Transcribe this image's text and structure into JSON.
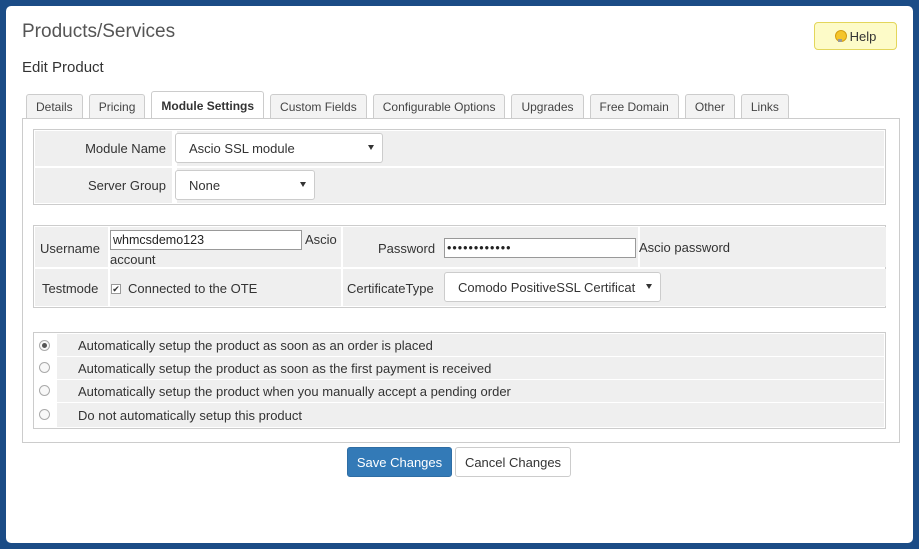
{
  "page": {
    "title": "Products/Services",
    "subtitle": "Edit Product"
  },
  "help": {
    "label": "Help",
    "icon": "lightbulb-icon"
  },
  "tabs": [
    {
      "label": "Details"
    },
    {
      "label": "Pricing"
    },
    {
      "label": "Module Settings",
      "active": true
    },
    {
      "label": "Custom Fields"
    },
    {
      "label": "Configurable Options"
    },
    {
      "label": "Upgrades"
    },
    {
      "label": "Free Domain"
    },
    {
      "label": "Other"
    },
    {
      "label": "Links"
    }
  ],
  "module": {
    "name_label": "Module Name",
    "name_value": "Ascio SSL module",
    "server_group_label": "Server Group",
    "server_group_value": "None"
  },
  "settings": {
    "username_label": "Username",
    "username_value": "whmcsdemo123",
    "username_desc_line1": "Ascio",
    "username_desc_line2": "account",
    "password_label": "Password",
    "password_value": "••••••••••••",
    "password_desc": "Ascio password",
    "testmode_label": "Testmode",
    "testmode_checked": true,
    "testmode_desc": "Connected to the OTE",
    "certtype_label": "CertificateType",
    "certtype_value": "Comodo PositiveSSL Certificat"
  },
  "setup_options": [
    {
      "label": "Automatically setup the product as soon as an order is placed",
      "checked": true
    },
    {
      "label": "Automatically setup the product as soon as the first payment is received",
      "checked": false
    },
    {
      "label": "Automatically setup the product when you manually accept a pending order",
      "checked": false
    },
    {
      "label": "Do not automatically setup this product",
      "checked": false
    }
  ],
  "actions": {
    "save_label": "Save Changes",
    "cancel_label": "Cancel Changes"
  },
  "colors": {
    "primary": "#337ab7",
    "help_bg": "#fdfbc8",
    "frame_bg": "#1b4c86"
  }
}
